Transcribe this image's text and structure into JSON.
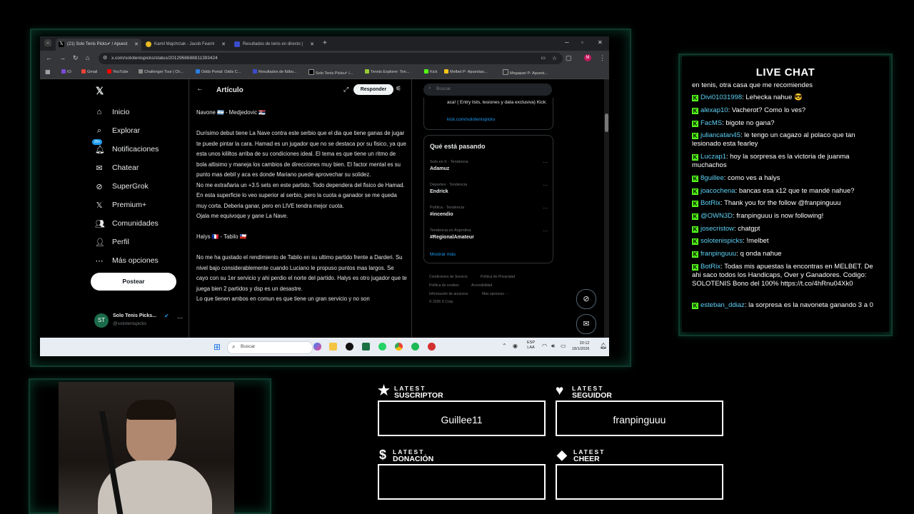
{
  "browser": {
    "tabs": [
      {
        "label": "(21) Solo Tenis Picks✔ / Apuest",
        "active": true
      },
      {
        "label": "Kamil Majchrzak - Jacob Fearnl",
        "active": false
      },
      {
        "label": "Resultados de tenis en directo |",
        "active": false
      }
    ],
    "url": "x.com/solotenispicks/status/2012968688811393424",
    "bookmarks": [
      "IO",
      "Gmail",
      "YouTube",
      "Challenger Tour | Ch...",
      "Odds Portal: Odds C...",
      "Resultados de fútbo...",
      "Solo Tenis Picks✔ /...",
      "Tennis Explorer: Ten...",
      "Kick",
      "Melbet P- Apuestas...",
      "Megapari P- Apuest..."
    ]
  },
  "x_nav": {
    "items": [
      "Inicio",
      "Explorar",
      "Notificaciones",
      "Chatear",
      "SuperGrok",
      "Premium+",
      "Comunidades",
      "Perfil",
      "Más opciones"
    ],
    "notif_badge": "20+",
    "post_button": "Postear",
    "profile_name": "Solo Tenis Picks...",
    "profile_handle": "@solotenispicks"
  },
  "article": {
    "header": "Artículo",
    "reply_button": "Responder",
    "paragraphs": [
      "Navone 🇦🇷 - Medjedovic 🇷🇸",
      "Durísimo debut tiene La Nave contra este serbio que el dia que tiene ganas de jugar te puede pintar la cara. Hamad es un jugador que no se destaca por su fisico, ya que esta unos kililtos arriba de su condiciones ideal. El tema es que tiene un ritmo de bola altisimo y maneja los cambios de direcciones muy bien. El factor mental es su punto mas debil y aca es donde Mariano puede aprovechar su solidez.\nNo me extrañaria un +3.5 sets en este partido. Todo dependera del fisico de Hamad. En esta superficie lo veo superior al serbio, pero la cuota a ganador se me queda muy corta. Deberia ganar, pero en LIVE tendra mejor cuota.\nOjala me equivoque y gane La Nave.",
      "Halys 🇫🇷 - Tabilo 🇨🇱",
      "No me ha gustado el rendimiento de Tabilo en su ultimo partido frente a Darderi. Su nivel bajo considerablemente cuando Luciano le propuso puntos mas largos. Se cayo con su 1er servicio y ahi perdio el norte del partido. Halys es otro jugador que te juega bien 2 partidos y dsp es un desastre.\nLo que tienen ambos en comun es que tiene un gran servicio y no son"
    ]
  },
  "sidebar": {
    "search_placeholder": "Buscar",
    "promo_text": "Toda la información del circuito la encontras aca! ( Entry lists, lesiones y data exclusiva) Kick:",
    "promo_link": "kick.com/solotenispicks",
    "trends_title": "Qué está pasando",
    "trends": [
      {
        "category": "Solo en X · Tendencia",
        "name": "Adamuz"
      },
      {
        "category": "Deportes · Tendencia",
        "name": "Endrick"
      },
      {
        "category": "Política · Tendencia",
        "name": "#incendio"
      },
      {
        "category": "Tendencia en Argentina",
        "name": "#RegionalAmateur"
      }
    ],
    "show_more": "Mostrar más",
    "footer": [
      "Condiciones de Servicio",
      "Política de Privacidad",
      "Política de cookies",
      "Accesibilidad",
      "Información de anuncios",
      "Más opciones ···",
      "© 2026 X Corp."
    ]
  },
  "taskbar": {
    "search_placeholder": "Buscar",
    "lang": "ESP",
    "lang2": "LAA",
    "time": "20:12",
    "date": "18/1/2026"
  },
  "chat": {
    "title": "LIVE CHAT",
    "top_text": "en tenis, otra casa que me recomiendes",
    "messages": [
      {
        "user": "Divi01031998",
        "text": "Lehecka nahue 😎"
      },
      {
        "user": "alexap10",
        "text": "Vacherot? Como lo ves?"
      },
      {
        "user": "FacMS",
        "text": "bigote no gana?"
      },
      {
        "user": "juliancatan45",
        "text": "le tengo un cagazo al polaco que tan lesionado esta fearley"
      },
      {
        "user": "Luczap1",
        "text": "hoy la sorpresa es la victoria de juanma muchachos"
      },
      {
        "user": "8guillee",
        "text": "como ves a halys"
      },
      {
        "user": "joacochena",
        "text": "bancas esa x12 que te mandé nahue?"
      },
      {
        "user": "BotRix",
        "text": "Thank you for the follow @franpinguuu"
      },
      {
        "user": "@OWN3D",
        "text": "franpinguuu is now following!"
      },
      {
        "user": "josecristow",
        "text": "chatgpt"
      },
      {
        "user": "solotenispicks",
        "text": "!melbet"
      },
      {
        "user": "franpinguuu",
        "text": "q onda nahue"
      },
      {
        "user": "BotRix",
        "text": "Todas mis apuestas la encontras en MELBET. De ahi saco todos los Handicaps, Over y Ganadores. Codigo: SOLOTENIS Bono del 100% https://t.co/4hRnu04Xk0"
      },
      {
        "user": "esteban_ddiaz",
        "text": "la sorpresa es la navoneta ganando 3 a 0"
      }
    ]
  },
  "widgets": {
    "suscriptor": {
      "small": "LATEST",
      "big": "SUSCRIPTOR",
      "value": "Guillee11"
    },
    "seguidor": {
      "small": "LATEST",
      "big": "SEGUIDOR",
      "value": "franpinguuu"
    },
    "donacion": {
      "small": "LATEST",
      "big": "DONACIÓN",
      "value": ""
    },
    "cheer": {
      "small": "LATEST",
      "big": "CHEER",
      "value": ""
    }
  },
  "colors": {
    "accent": "#53fc18",
    "chat_user": "#5fd1f5",
    "x_link": "#1d9bf0",
    "frame": "#0f3a2e"
  }
}
